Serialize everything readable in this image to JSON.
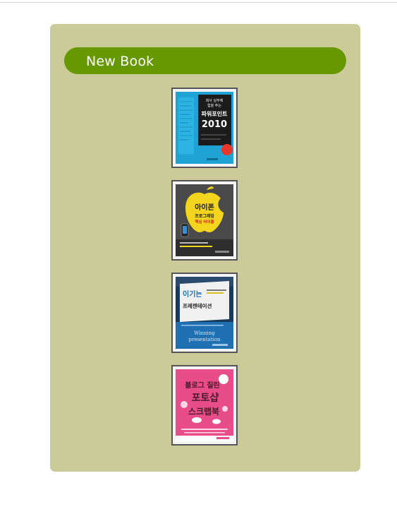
{
  "section": {
    "title": "New Book"
  },
  "books": [
    {
      "cover_lines": [
        "회사 실무에",
        "힘을 주는",
        "파워포인트",
        "2010"
      ],
      "badge": "",
      "colors": {
        "background": "#1fa3d4",
        "panel": "#1b1b1b",
        "accent": "#e8362b",
        "text": "#ffffff"
      }
    },
    {
      "cover_lines": [
        "아이폰",
        "프로그래밍",
        "핵심 바이블"
      ],
      "badge": "",
      "colors": {
        "background": "#4a4a4a",
        "panel": "#f2d51c",
        "accent": "#d62828",
        "text": "#1b1b1b"
      }
    },
    {
      "cover_lines": [
        "이기는",
        "프레젠테이션",
        "Winning",
        "presentation"
      ],
      "badge": "",
      "colors": {
        "background": "#1f6fb3",
        "panel": "#f1f1f1",
        "accent": "#3a8fd0",
        "text": "#1f1f1f"
      }
    },
    {
      "cover_lines": [
        "블로그 질린",
        "포토샵",
        "스크랩북"
      ],
      "badge": "",
      "colors": {
        "background": "#e84d8a",
        "panel": "#ffffff",
        "accent": "#ffd6e6",
        "text": "#4a1a2a"
      }
    }
  ]
}
